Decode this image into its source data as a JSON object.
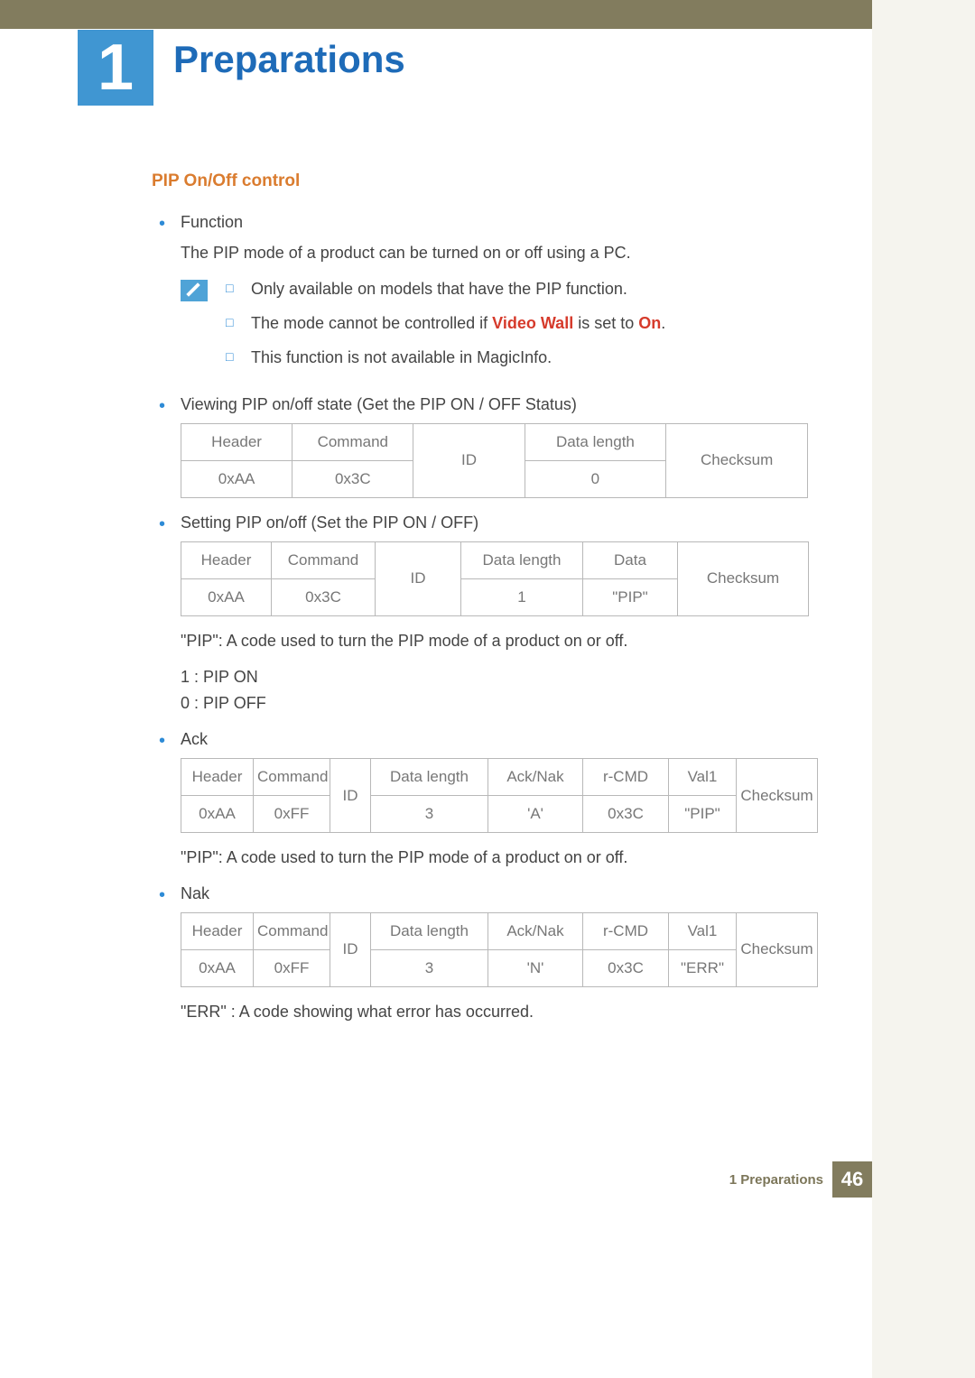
{
  "chapter": {
    "number": "1",
    "title": "Preparations"
  },
  "section": {
    "title": "PIP On/Off control"
  },
  "function": {
    "label": "Function",
    "desc": "The PIP mode of a product can be turned on or off using a PC."
  },
  "notes": {
    "n1": "Only available on models that have the PIP function.",
    "n2a": "The mode cannot be controlled if ",
    "n2b": "Video Wall",
    "n2c": " is set to ",
    "n2d": "On",
    "n2e": ".",
    "n3": "This function is not available in MagicInfo."
  },
  "viewing": {
    "label": "Viewing PIP on/off state (Get the PIP ON / OFF Status)"
  },
  "t1": {
    "h_header": "Header",
    "h_command": "Command",
    "h_id": "ID",
    "h_datalen": "Data length",
    "h_checksum": "Checksum",
    "v_header": "0xAA",
    "v_command": "0x3C",
    "v_datalen": "0"
  },
  "setting": {
    "label": "Setting PIP on/off (Set the PIP ON / OFF)"
  },
  "t2": {
    "h_header": "Header",
    "h_command": "Command",
    "h_id": "ID",
    "h_datalen": "Data length",
    "h_data": "Data",
    "h_checksum": "Checksum",
    "v_header": "0xAA",
    "v_command": "0x3C",
    "v_datalen": "1",
    "v_data": "\"PIP\""
  },
  "pip_desc": "\"PIP\": A code used to turn the PIP mode of a product on or off.",
  "pip_on": "1 : PIP ON",
  "pip_off": "0 : PIP OFF",
  "ack": {
    "label": "Ack"
  },
  "t3": {
    "h_header": "Header",
    "h_command": "Command",
    "h_id": "ID",
    "h_datalen": "Data length",
    "h_acknak": "Ack/Nak",
    "h_rcmd": "r-CMD",
    "h_val1": "Val1",
    "h_checksum": "Checksum",
    "v_header": "0xAA",
    "v_command": "0xFF",
    "v_datalen": "3",
    "v_acknak": "'A'",
    "v_rcmd": "0x3C",
    "v_val1": "\"PIP\""
  },
  "ack_desc": "\"PIP\": A code used to turn the PIP mode of a product on or off.",
  "nak": {
    "label": "Nak"
  },
  "t4": {
    "h_header": "Header",
    "h_command": "Command",
    "h_id": "ID",
    "h_datalen": "Data length",
    "h_acknak": "Ack/Nak",
    "h_rcmd": "r-CMD",
    "h_val1": "Val1",
    "h_checksum": "Checksum",
    "v_header": "0xAA",
    "v_command": "0xFF",
    "v_datalen": "3",
    "v_acknak": "'N'",
    "v_rcmd": "0x3C",
    "v_val1": "\"ERR\""
  },
  "err_desc": "\"ERR\" : A code showing what error has occurred.",
  "footer": {
    "label": "1 Preparations",
    "page": "46"
  }
}
